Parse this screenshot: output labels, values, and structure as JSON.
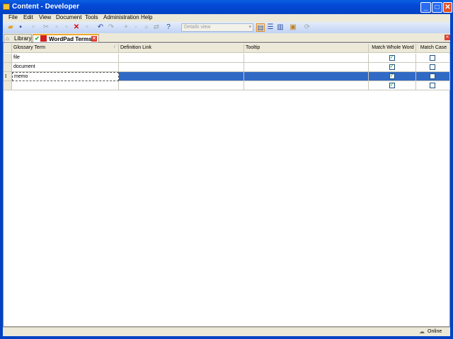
{
  "window": {
    "title": "Content - Developer"
  },
  "menu": [
    "File",
    "Edit",
    "View",
    "Document",
    "Tools",
    "Administration",
    "Help"
  ],
  "toolbar": {
    "view_combo": "Details view"
  },
  "tabs": [
    {
      "label": "Library",
      "active": false
    },
    {
      "label": "WordPad Terms",
      "active": true
    }
  ],
  "grid": {
    "columns": [
      "Glossary Term",
      "Definition Link",
      "Tooltip",
      "Match Whole Word",
      "Match Case"
    ],
    "rows": [
      {
        "term": "file",
        "link": "",
        "tooltip": "",
        "whole": true,
        "case": false
      },
      {
        "term": "document",
        "link": "",
        "tooltip": "",
        "whole": true,
        "case": false
      },
      {
        "term": "memo",
        "link": "",
        "tooltip": "",
        "whole": true,
        "case": false,
        "selected": true,
        "editing": true
      },
      {
        "term": "",
        "link": "",
        "tooltip": "",
        "whole": true,
        "case": false
      }
    ]
  },
  "status": {
    "connection": "Online"
  },
  "colors": {
    "titlebar": "#0348d6",
    "selection": "#316ac5"
  }
}
